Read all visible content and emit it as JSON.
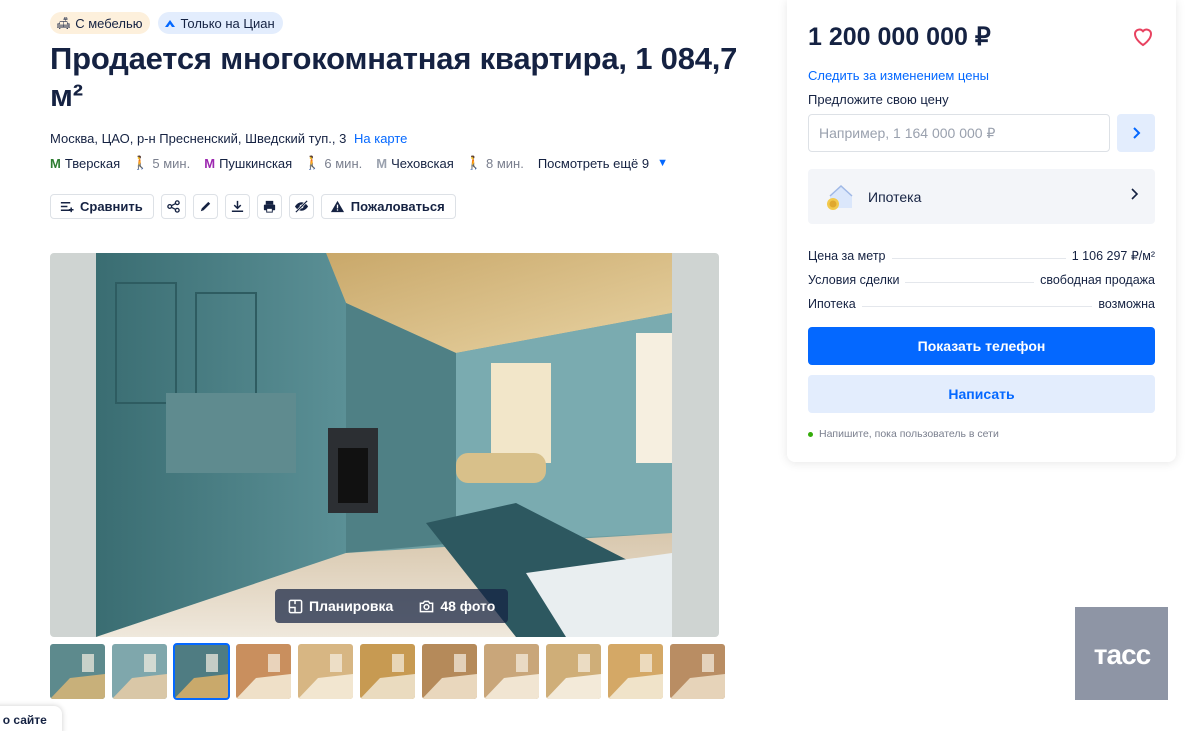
{
  "badges": {
    "furniture": "С мебелью",
    "cian_only": "Только на Циан"
  },
  "title": "Продается многокомнатная квартира, 1 084,7 м²",
  "address": {
    "text": "Москва, ЦАО, р-н Пресненский, Шведский туп., 3",
    "map_link": "На карте"
  },
  "metro": [
    {
      "name": "Тверская",
      "time": "5 мин.",
      "color": "#2e7d32"
    },
    {
      "name": "Пушкинская",
      "time": "6 мин.",
      "color": "#9c27b0"
    },
    {
      "name": "Чеховская",
      "time": "8 мин.",
      "color": "#9aa1ae"
    }
  ],
  "metro_more": "Посмотреть ещё 9",
  "actions": {
    "compare": "Сравнить",
    "complain": "Пожаловаться"
  },
  "gallery": {
    "plan": "Планировка",
    "photos": "48 фото",
    "thumb_count": 11,
    "active_thumb": 3
  },
  "about_tab": "в о сайте",
  "card": {
    "price": "1 200 000 000 ₽",
    "follow": "Следить за изменением цены",
    "offer_label": "Предложите свою цену",
    "offer_placeholder": "Например, 1 164 000 000 ₽",
    "mortgage": "Ипотека",
    "details": [
      {
        "key": "Цена за метр",
        "value": "1 106 297 ₽/м²"
      },
      {
        "key": "Условия сделки",
        "value": "свободная продажа"
      },
      {
        "key": "Ипотека",
        "value": "возможна"
      }
    ],
    "phone_button": "Показать телефон",
    "write_button": "Написать",
    "online_note": "Напишите, пока пользователь в сети"
  },
  "watermark": "ТАСС",
  "colors": {
    "accent": "#0468ff",
    "accent_light": "#e3edfd",
    "text": "#152242",
    "online": "#34ac0a"
  }
}
